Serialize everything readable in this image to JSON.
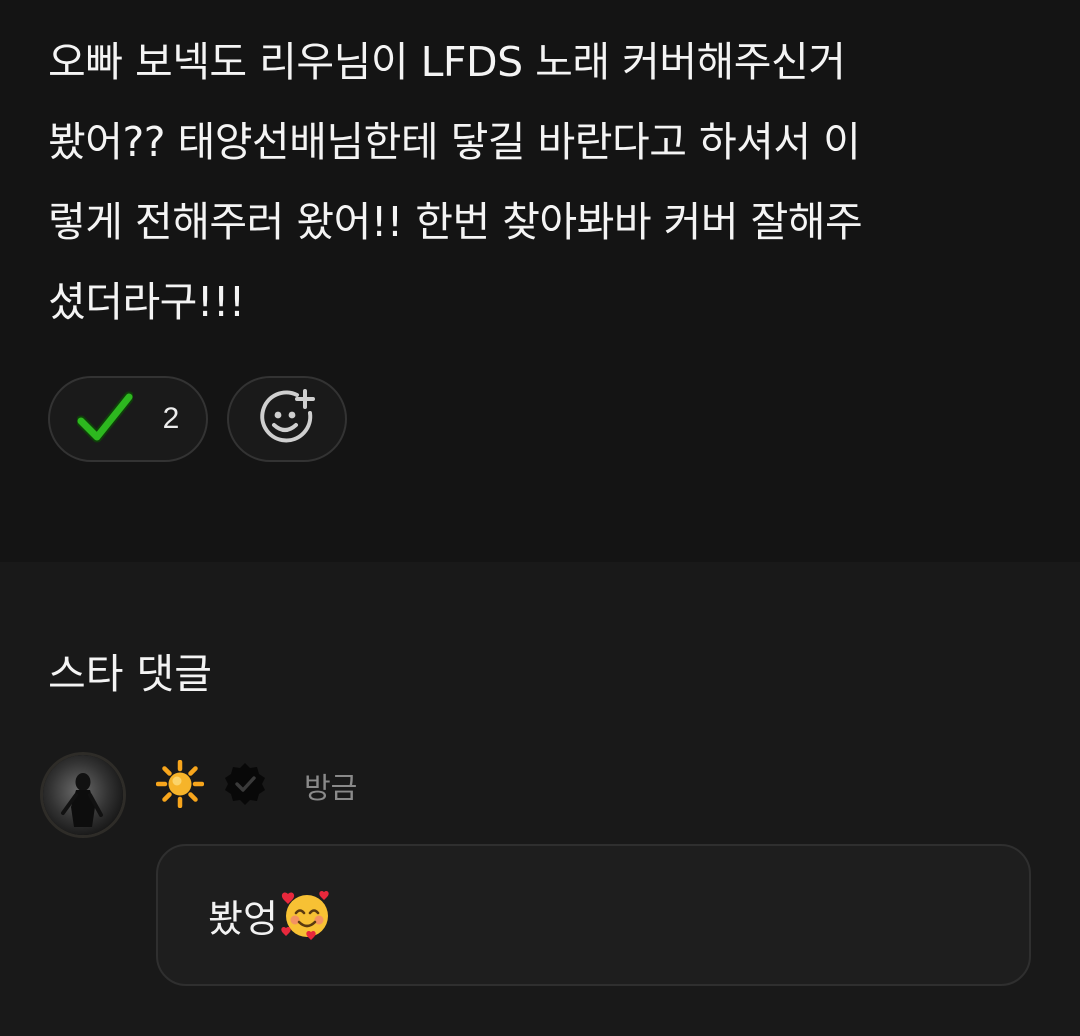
{
  "post": {
    "body": "오빠 보넥도 리우님이 LFDS 노래 커버해주신거\n봤어?? 태양선배님한테 닿길 바란다고 하셔서 이\n렇게 전해주러 왔어!! 한번 찾아봐바 커버 잘해주\n셨더라구!!!"
  },
  "reactions": {
    "check": {
      "icon": "check-mark-icon",
      "count": "2",
      "color": "#2db81f"
    },
    "add": {
      "icon": "add-reaction-icon"
    }
  },
  "comments": {
    "section_title": "스타 댓글",
    "items": [
      {
        "author_icon": "sun-emoji-icon",
        "badge_icon": "verified-badge-icon",
        "time": "방금",
        "text": "봤엉",
        "text_emoji": "smiling-face-with-hearts-icon"
      }
    ]
  },
  "colors": {
    "background": "#141414",
    "comment_background": "#191919",
    "bubble_background": "#1e1e1e",
    "check_green": "#2db81f"
  }
}
